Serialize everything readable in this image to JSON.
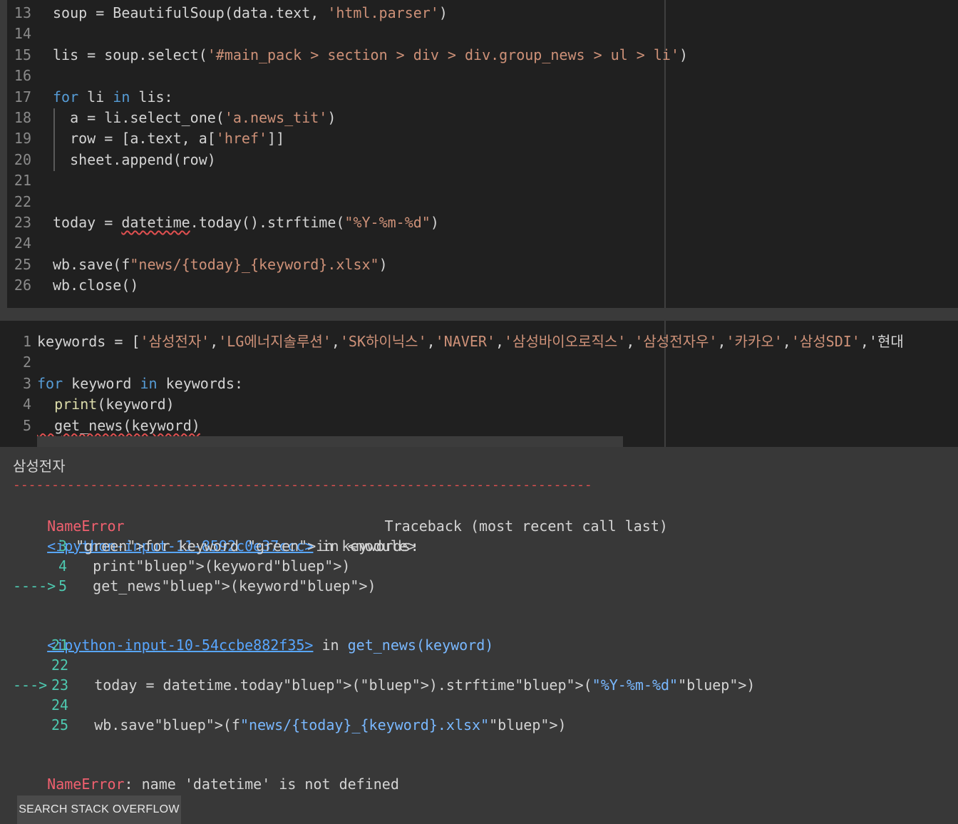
{
  "cell1": {
    "lines": [
      {
        "n": "13",
        "code": "soup = BeautifulSoup(data.text, 'html.parser')"
      },
      {
        "n": "14",
        "code": ""
      },
      {
        "n": "15",
        "code": "lis = soup.select('#main_pack > section > div > div.group_news > ul > li')"
      },
      {
        "n": "16",
        "code": ""
      },
      {
        "n": "17",
        "code": "for li in lis:"
      },
      {
        "n": "18",
        "code": "  a = li.select_one('a.news_tit')"
      },
      {
        "n": "19",
        "code": "  row = [a.text, a['href']]"
      },
      {
        "n": "20",
        "code": "  sheet.append(row)"
      },
      {
        "n": "21",
        "code": ""
      },
      {
        "n": "22",
        "code": ""
      },
      {
        "n": "23",
        "code": "today = datetime.today().strftime(\"%Y-%m-%d\")"
      },
      {
        "n": "24",
        "code": ""
      },
      {
        "n": "25",
        "code": "wb.save(f\"news/{today}_{keyword}.xlsx\")"
      },
      {
        "n": "26",
        "code": "wb.close()"
      }
    ]
  },
  "cell2": {
    "lines": [
      {
        "n": "1",
        "code": "keywords = ['삼성전자','LG에너지솔루션','SK하이닉스','NAVER','삼성바이오로직스','삼성전자우','카카오','삼성SDI','현대"
      },
      {
        "n": "2",
        "code": ""
      },
      {
        "n": "3",
        "code": "for keyword in keywords:"
      },
      {
        "n": "4",
        "code": "  print(keyword)"
      },
      {
        "n": "5",
        "code": "  get_news(keyword)"
      }
    ]
  },
  "output": {
    "printed": "삼성전자",
    "dashes": "---------------------------------------------------------------------------",
    "error_name": "NameError",
    "traceback_header": "Traceback (most recent call last)",
    "frame1_link": "<ipython-input-11-8592c0e37ccc>",
    "frame1_in": " in <module>",
    "frame1_lines": [
      {
        "arrow": "",
        "n": "3",
        "code": "for keyword in keywords:"
      },
      {
        "arrow": "",
        "n": "4",
        "code": "  print(keyword)"
      },
      {
        "arrow": "---->",
        "n": "5",
        "code": "  get_news(keyword)"
      }
    ],
    "frame2_link": "<ipython-input-10-54ccbe882f35>",
    "frame2_in": " in ",
    "frame2_func": "get_news(keyword)",
    "frame2_lines": [
      {
        "arrow": "",
        "n": "21",
        "code": ""
      },
      {
        "arrow": "",
        "n": "22",
        "code": ""
      },
      {
        "arrow": "--->",
        "n": "23",
        "code": "  today = datetime.today().strftime(\"%Y-%m-%d\")"
      },
      {
        "arrow": "",
        "n": "24",
        "code": ""
      },
      {
        "arrow": "",
        "n": "25",
        "code": "  wb.save(f\"news/{today}_{keyword}.xlsx\")"
      }
    ],
    "final_error_name": "NameError",
    "final_error_msg": ": name 'datetime' is not defined"
  },
  "buttons": {
    "search_stack_overflow": "SEARCH STACK OVERFLOW"
  },
  "colors": {
    "editor_bg": "#202020",
    "output_bg": "#383838",
    "keyword": "#569cd6",
    "string": "#ce9178",
    "error": "#f0606f",
    "link": "#58a6ff"
  }
}
